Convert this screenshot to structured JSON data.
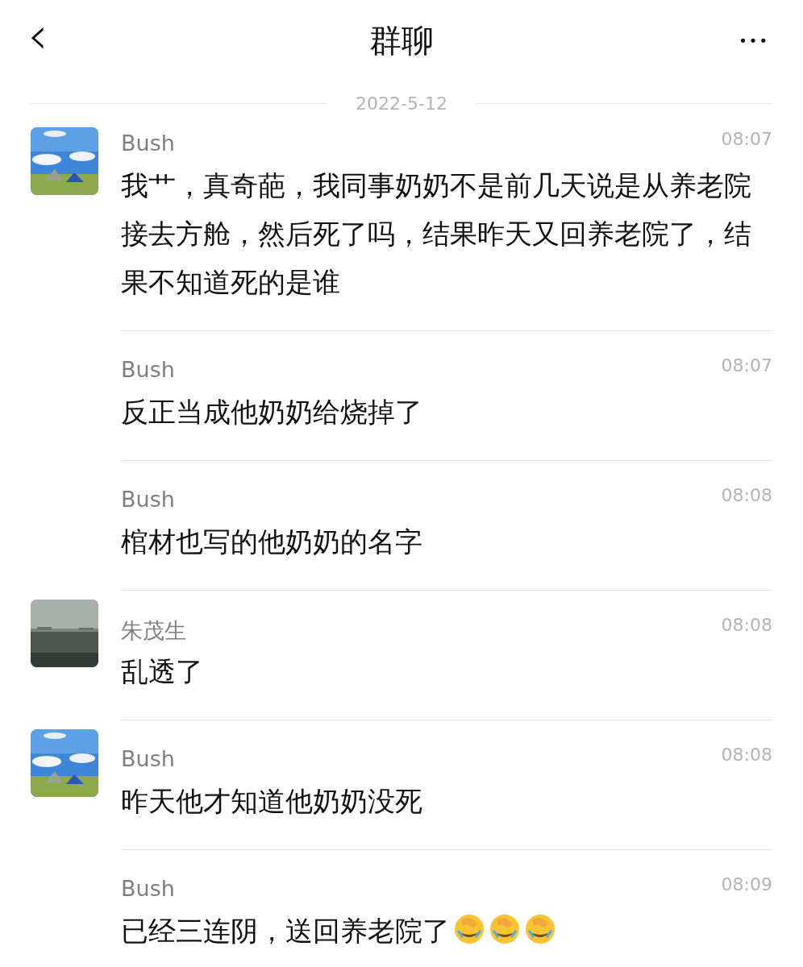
{
  "header": {
    "back": "‹",
    "title": "群聊",
    "more": "•••"
  },
  "date": "2022-5-12",
  "messages": [
    {
      "sender": "Bush",
      "time": "08:07",
      "text": "我艹，真奇葩，我同事奶奶不是前几天说是从养老院接去方舱，然后死了吗，结果昨天又回养老院了，结果不知道死的是谁",
      "avatar": {
        "kind": "meadow"
      }
    },
    {
      "sender": "Bush",
      "time": "08:07",
      "text": "反正当成他奶奶给烧掉了"
    },
    {
      "sender": "Bush",
      "time": "08:08",
      "text": "棺材也写的他奶奶的名字"
    },
    {
      "sender": "朱茂生",
      "time": "08:08",
      "text": "乱透了",
      "avatar": {
        "kind": "fog"
      }
    },
    {
      "sender": "Bush",
      "time": "08:08",
      "text": "昨天他才知道他奶奶没死",
      "avatar": {
        "kind": "meadow"
      }
    },
    {
      "sender": "Bush",
      "time": "08:09",
      "text": "已经三连阴，送回养老院了",
      "emojis": [
        {
          "kind": "facepalm"
        },
        {
          "kind": "facepalm"
        },
        {
          "kind": "facepalm"
        }
      ]
    }
  ]
}
